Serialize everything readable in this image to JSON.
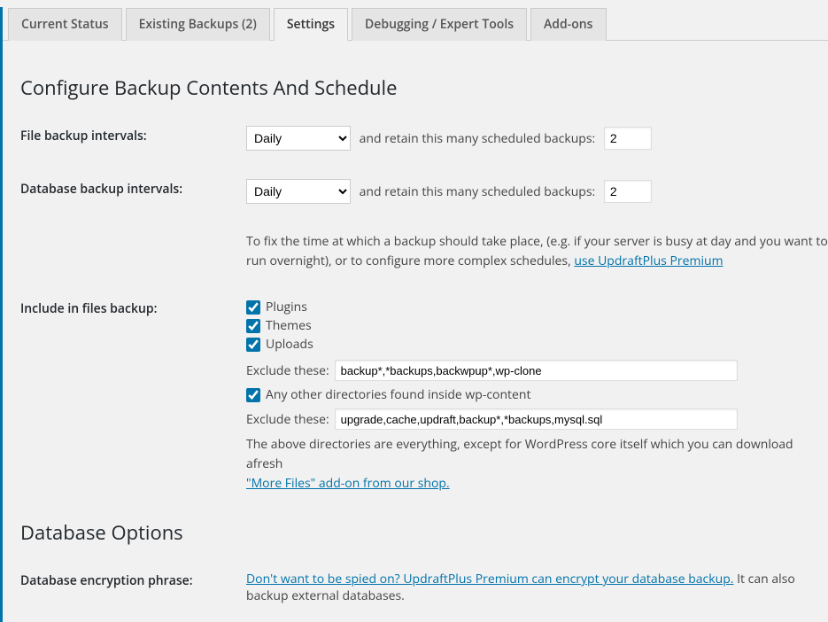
{
  "tabs": [
    {
      "label": "Current Status"
    },
    {
      "label": "Existing Backups (2)"
    },
    {
      "label": "Settings"
    },
    {
      "label": "Debugging / Expert Tools"
    },
    {
      "label": "Add-ons"
    }
  ],
  "section1": {
    "title": "Configure Backup Contents And Schedule",
    "file_intervals": {
      "label": "File backup intervals:",
      "value": "Daily",
      "retain_text": "and retain this many scheduled backups:",
      "retain_value": "2"
    },
    "db_intervals": {
      "label": "Database backup intervals:",
      "value": "Daily",
      "retain_text": "and retain this many scheduled backups:",
      "retain_value": "2"
    },
    "schedule_help": {
      "text": "To fix the time at which a backup should take place, (e.g. if your server is busy at day and you want to run overnight), or to configure more complex schedules, ",
      "link": "use UpdraftPlus Premium"
    },
    "include": {
      "label": "Include in files backup:",
      "items": [
        {
          "label": "Plugins",
          "checked": true
        },
        {
          "label": "Themes",
          "checked": true
        },
        {
          "label": "Uploads",
          "checked": true
        }
      ],
      "exclude1_label": "Exclude these:",
      "exclude1_value": "backup*,*backups,backwpup*,wp-clone",
      "other_dirs": {
        "label": "Any other directories found inside wp-content",
        "checked": true
      },
      "exclude2_label": "Exclude these:",
      "exclude2_value": "upgrade,cache,updraft,backup*,*backups,mysql.sql",
      "note_text": "The above directories are everything, except for WordPress core itself which you can download afresh",
      "note_link": "\"More Files\" add-on from our shop."
    }
  },
  "section2": {
    "title": "Database Options",
    "encryption": {
      "label": "Database encryption phrase:",
      "link": "Don't want to be spied on? UpdraftPlus Premium can encrypt your database backup.",
      "trail": " It can also backup external databases."
    }
  }
}
